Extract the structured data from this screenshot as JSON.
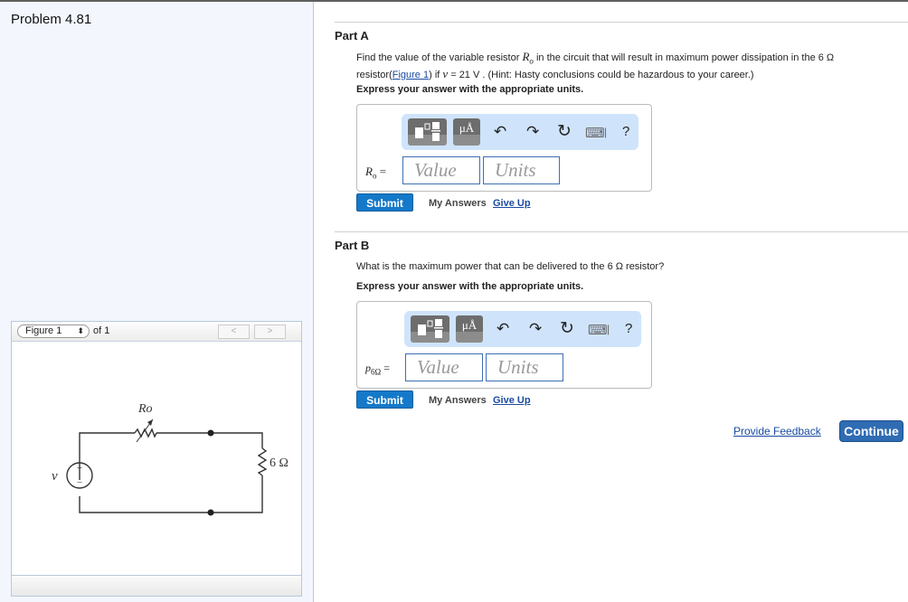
{
  "problem": {
    "title": "Problem 4.81"
  },
  "figure": {
    "selector_value": "Figure 1",
    "of_label": "of 1",
    "prev_label": "<",
    "next_label": ">",
    "circuit": {
      "source_label": "v",
      "plus": "+",
      "minus": "−",
      "variable_resistor_label": "Ro",
      "load_resistor_label": "6 Ω"
    }
  },
  "partA": {
    "title": "Part A",
    "question_pre": "Find the value of the variable resistor ",
    "question_var": "R",
    "question_var_sub": "o",
    "question_mid": " in the circuit that will result in maximum power dissipation in the 6 Ω",
    "question_line2_pre": "resistor(",
    "figure_link": "Figure 1",
    "question_line2_mid": ") if ",
    "v_var": "v",
    "question_line2_post": " = 21 V . (Hint: Hasty conclusions could be hazardous to your career.)",
    "express": "Express your answer with the appropriate units.",
    "answer_label": "Ro =",
    "value_placeholder": "Value",
    "units_placeholder": "Units",
    "submit": "Submit",
    "my_answers": "My Answers",
    "give_up": "Give Up"
  },
  "partB": {
    "title": "Part B",
    "question": "What is the maximum power that can be delivered to the 6 Ω resistor?",
    "express": "Express your answer with the appropriate units.",
    "answer_label": "p6Ω =",
    "value_placeholder": "Value",
    "units_placeholder": "Units",
    "submit": "Submit",
    "my_answers": "My Answers",
    "give_up": "Give Up"
  },
  "toolbar": {
    "units_button": "μÅ",
    "undo": "↶",
    "redo": "↷",
    "reset": "↻",
    "keyboard": "⌨",
    "help": "?"
  },
  "footer": {
    "provide_feedback": "Provide Feedback",
    "continue": "Continue"
  }
}
